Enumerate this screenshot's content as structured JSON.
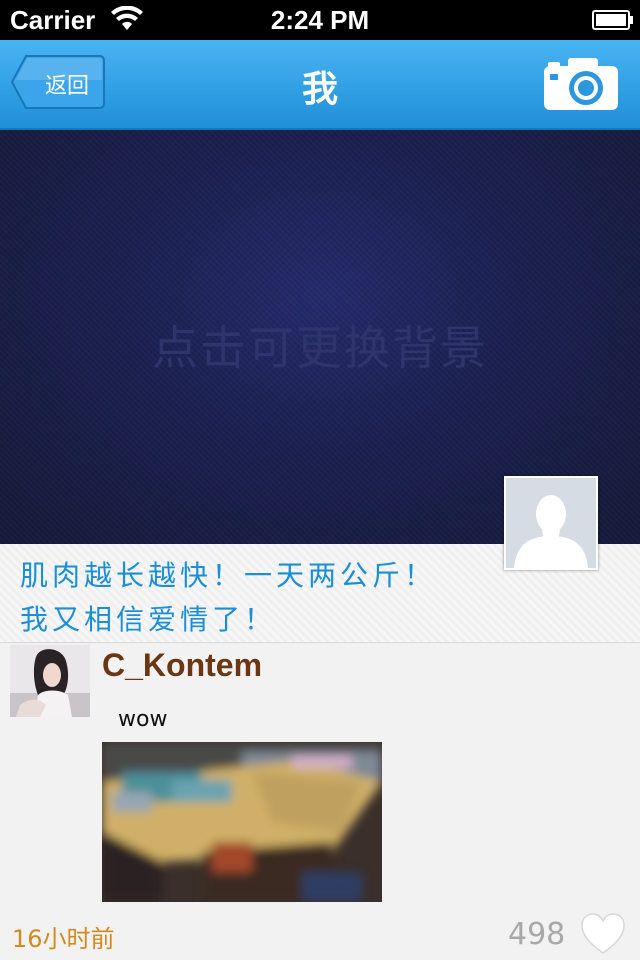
{
  "status_bar": {
    "carrier": "Carrier",
    "time": "2:24 PM"
  },
  "nav": {
    "back_label": "返回",
    "title": "我",
    "back_icon": "back-arrow-icon",
    "camera_icon": "camera-icon"
  },
  "cover": {
    "hint": "点击可更换背景"
  },
  "profile": {
    "signature_line1": "肌肉越长越快！一天两公斤！",
    "signature_line2": "我又相信爱情了！"
  },
  "feed": {
    "items": [
      {
        "username": "C_Kontem",
        "text": "wow",
        "time": "16小时前",
        "likes": "498"
      }
    ]
  },
  "colors": {
    "nav_blue": "#2d9fe6",
    "accent_blue": "#1a8fd5",
    "username_brown": "#6a3614",
    "time_orange": "#d28a1e"
  }
}
